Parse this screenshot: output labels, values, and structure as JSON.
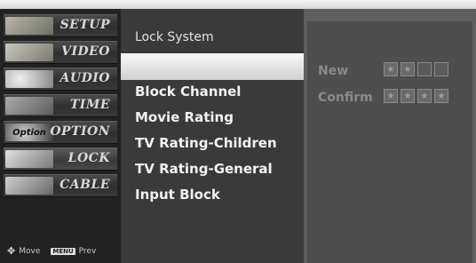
{
  "menu": {
    "items": [
      {
        "label": "SETUP",
        "icon": "setup-icon",
        "color": "#8a8f86"
      },
      {
        "label": "VIDEO",
        "icon": "video-icon",
        "color": "#9d9b90"
      },
      {
        "label": "AUDIO",
        "icon": "audio-icon",
        "color": "#a6a6a6"
      },
      {
        "label": "TIME",
        "icon": "time-icon",
        "color": "#8c8c8c"
      },
      {
        "label": "OPTION",
        "icon": "option-icon",
        "color": "#7a7a7a",
        "thumb_text": "Option"
      },
      {
        "label": "LOCK",
        "icon": "lock-icon",
        "color": "#b0b0b0"
      },
      {
        "label": "CABLE",
        "icon": "cable-icon",
        "color": "#9a9a9a"
      }
    ],
    "footer": {
      "move": "Move",
      "prev_key": "MENU",
      "prev": "Prev"
    }
  },
  "lock_menu": {
    "title": "Lock System",
    "items": [
      "Block Channel",
      "Movie Rating",
      "TV Rating-Children",
      "TV Rating-General",
      "Input Block"
    ]
  },
  "password": {
    "new_label": "New",
    "confirm_label": "Confirm",
    "mask_char": "★",
    "new_digits_entered": 2,
    "confirm_digits_entered": 4,
    "digits_total": 4
  }
}
